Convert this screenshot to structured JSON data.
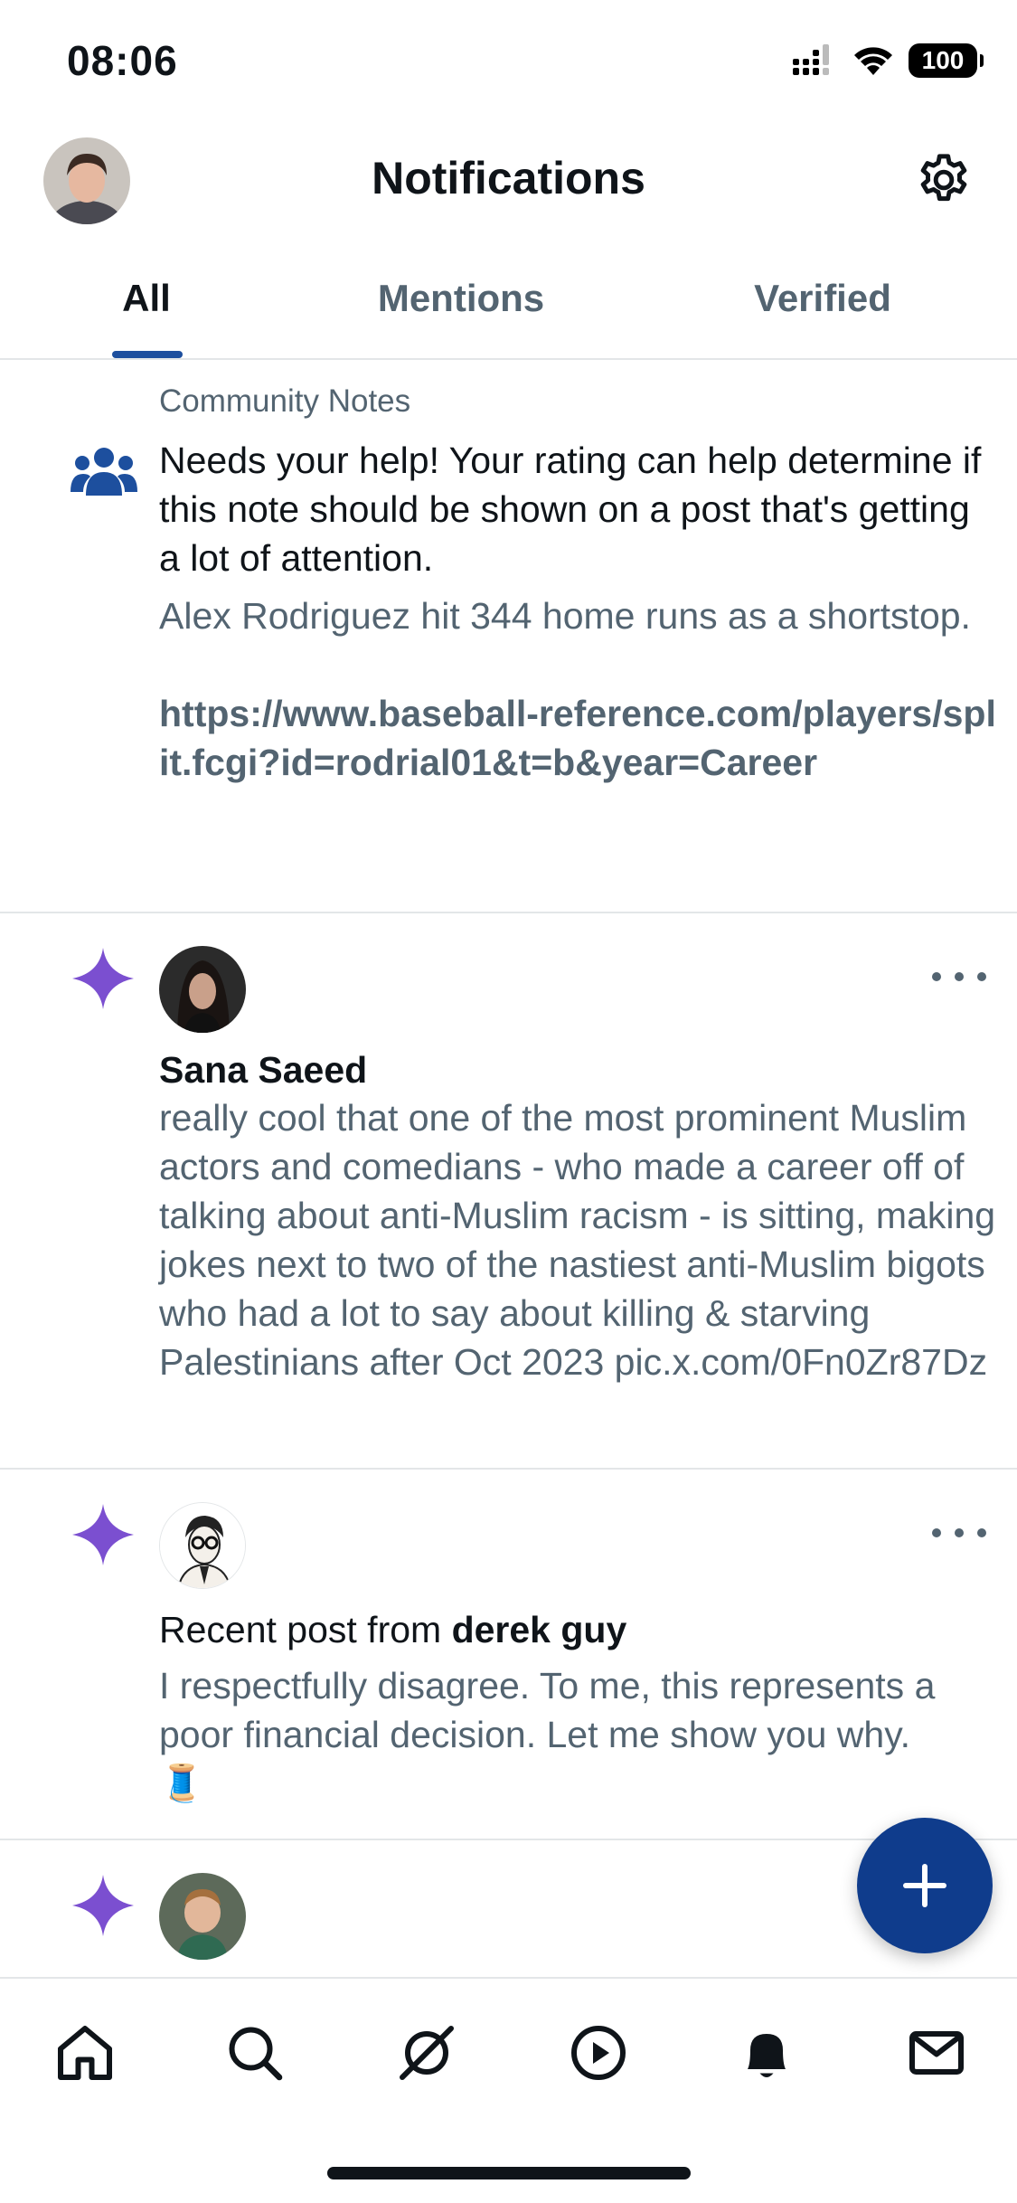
{
  "status_bar": {
    "time": "08:06",
    "battery": "100"
  },
  "header": {
    "title": "Notifications"
  },
  "tabs": [
    {
      "label": "All",
      "active": true
    },
    {
      "label": "Mentions",
      "active": false
    },
    {
      "label": "Verified",
      "active": false
    }
  ],
  "notifications": [
    {
      "type": "community-notes",
      "label": "Community Notes",
      "headline": "Needs your help! Your rating can help determine if this note should be shown on a post that's getting a lot of attention.",
      "note_text": "Alex Rodriguez hit 344 home runs as a shortstop.",
      "note_link": "https://www.baseball-reference.com/players/split.fcgi?id=rodrial01&t=b&year=Career"
    },
    {
      "type": "post",
      "author": "Sana Saeed",
      "text": "really cool that one of the most prominent Muslim actors and comedians - who made a career off of talking about anti-Muslim racism - is sitting, making jokes next to two of the nastiest anti-Muslim bigots who had a lot to say about killing & starving Palestinians after Oct 2023 pic.x.com/0Fn0Zr87Dz"
    },
    {
      "type": "recent-post",
      "prefix": "Recent post from ",
      "author": "derek guy",
      "text": "I respectfully disagree. To me, this represents a poor financial decision. Let me show you why.",
      "emoji": "🧵"
    },
    {
      "type": "post"
    }
  ],
  "colors": {
    "accent": "#1d4f9e",
    "fab": "#0f3c8c",
    "sparkle": "#7b4fd0",
    "muted": "#536471"
  },
  "bottom_nav": [
    "home-icon",
    "search-icon",
    "grok-icon",
    "video-icon",
    "notifications-icon",
    "messages-icon"
  ]
}
